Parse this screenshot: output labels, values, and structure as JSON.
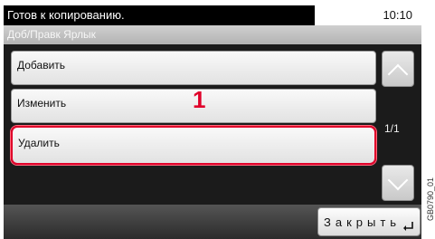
{
  "status": {
    "message": "Готов к копированию.",
    "time": "10:10"
  },
  "subheader": {
    "title": "Доб/Правк Ярлык"
  },
  "list": {
    "items": [
      {
        "label": "Добавить"
      },
      {
        "label": "Изменить"
      },
      {
        "label": "Удалить"
      }
    ]
  },
  "callout": {
    "number": "1"
  },
  "pagination": {
    "label": "1/1"
  },
  "footer": {
    "close_label": "Закрыть"
  },
  "figure_id": "GB0790_01",
  "colors": {
    "highlight": "#e0002a"
  }
}
